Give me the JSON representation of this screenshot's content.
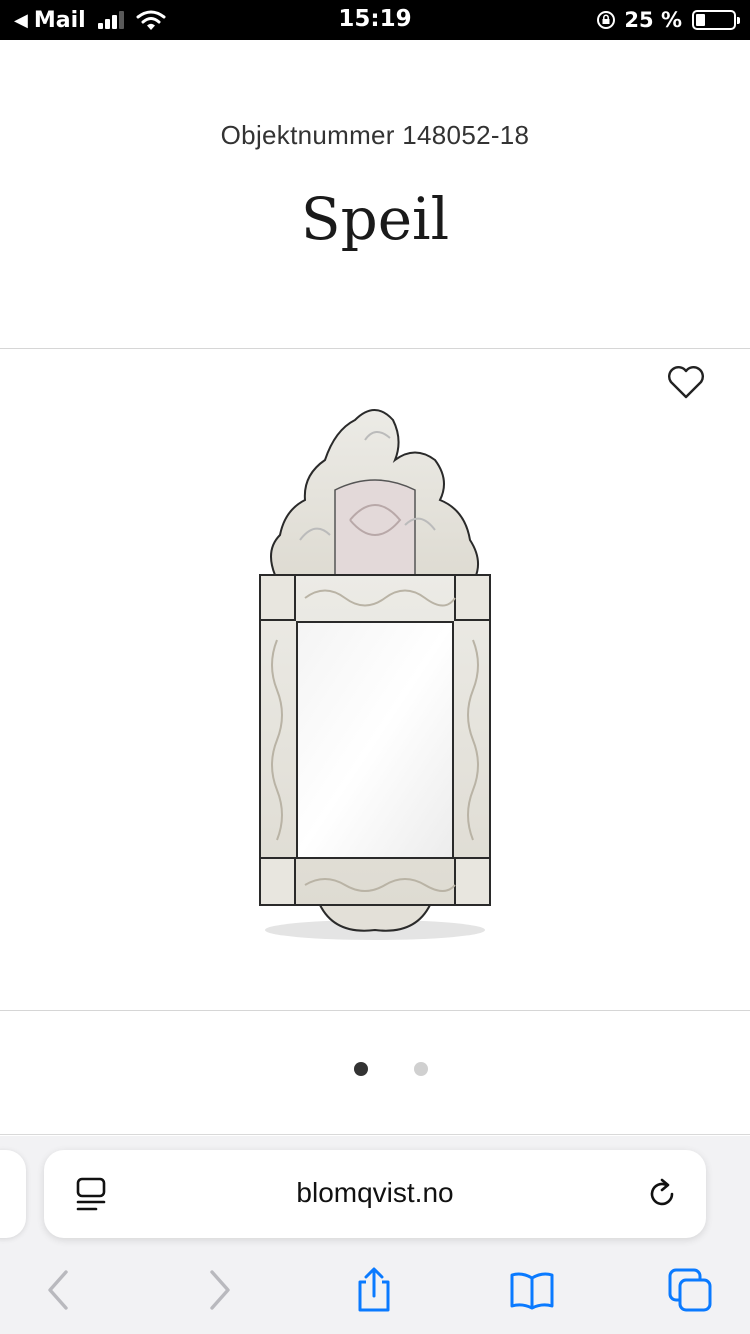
{
  "status_bar": {
    "back_app": "Mail",
    "time": "15:19",
    "battery_percent_text": "25 %",
    "battery_level": 0.25
  },
  "header": {
    "object_number": "Objektnummer 148052-18",
    "title": "Speil"
  },
  "gallery": {
    "image_count": 2,
    "active_index": 0
  },
  "browser": {
    "address": "blomqvist.no"
  },
  "icons": {
    "favorite": "heart-outline-icon",
    "reader": "reader-mode-icon",
    "reload": "reload-icon",
    "back": "chevron-left-icon",
    "forward": "chevron-right-icon",
    "share": "share-icon",
    "bookmarks": "book-icon",
    "tabs": "tabs-icon"
  },
  "colors": {
    "accent": "#0a7aff",
    "disabled": "#b9b9be",
    "dot_active": "#333333",
    "dot_inactive": "#d0d0d0"
  }
}
